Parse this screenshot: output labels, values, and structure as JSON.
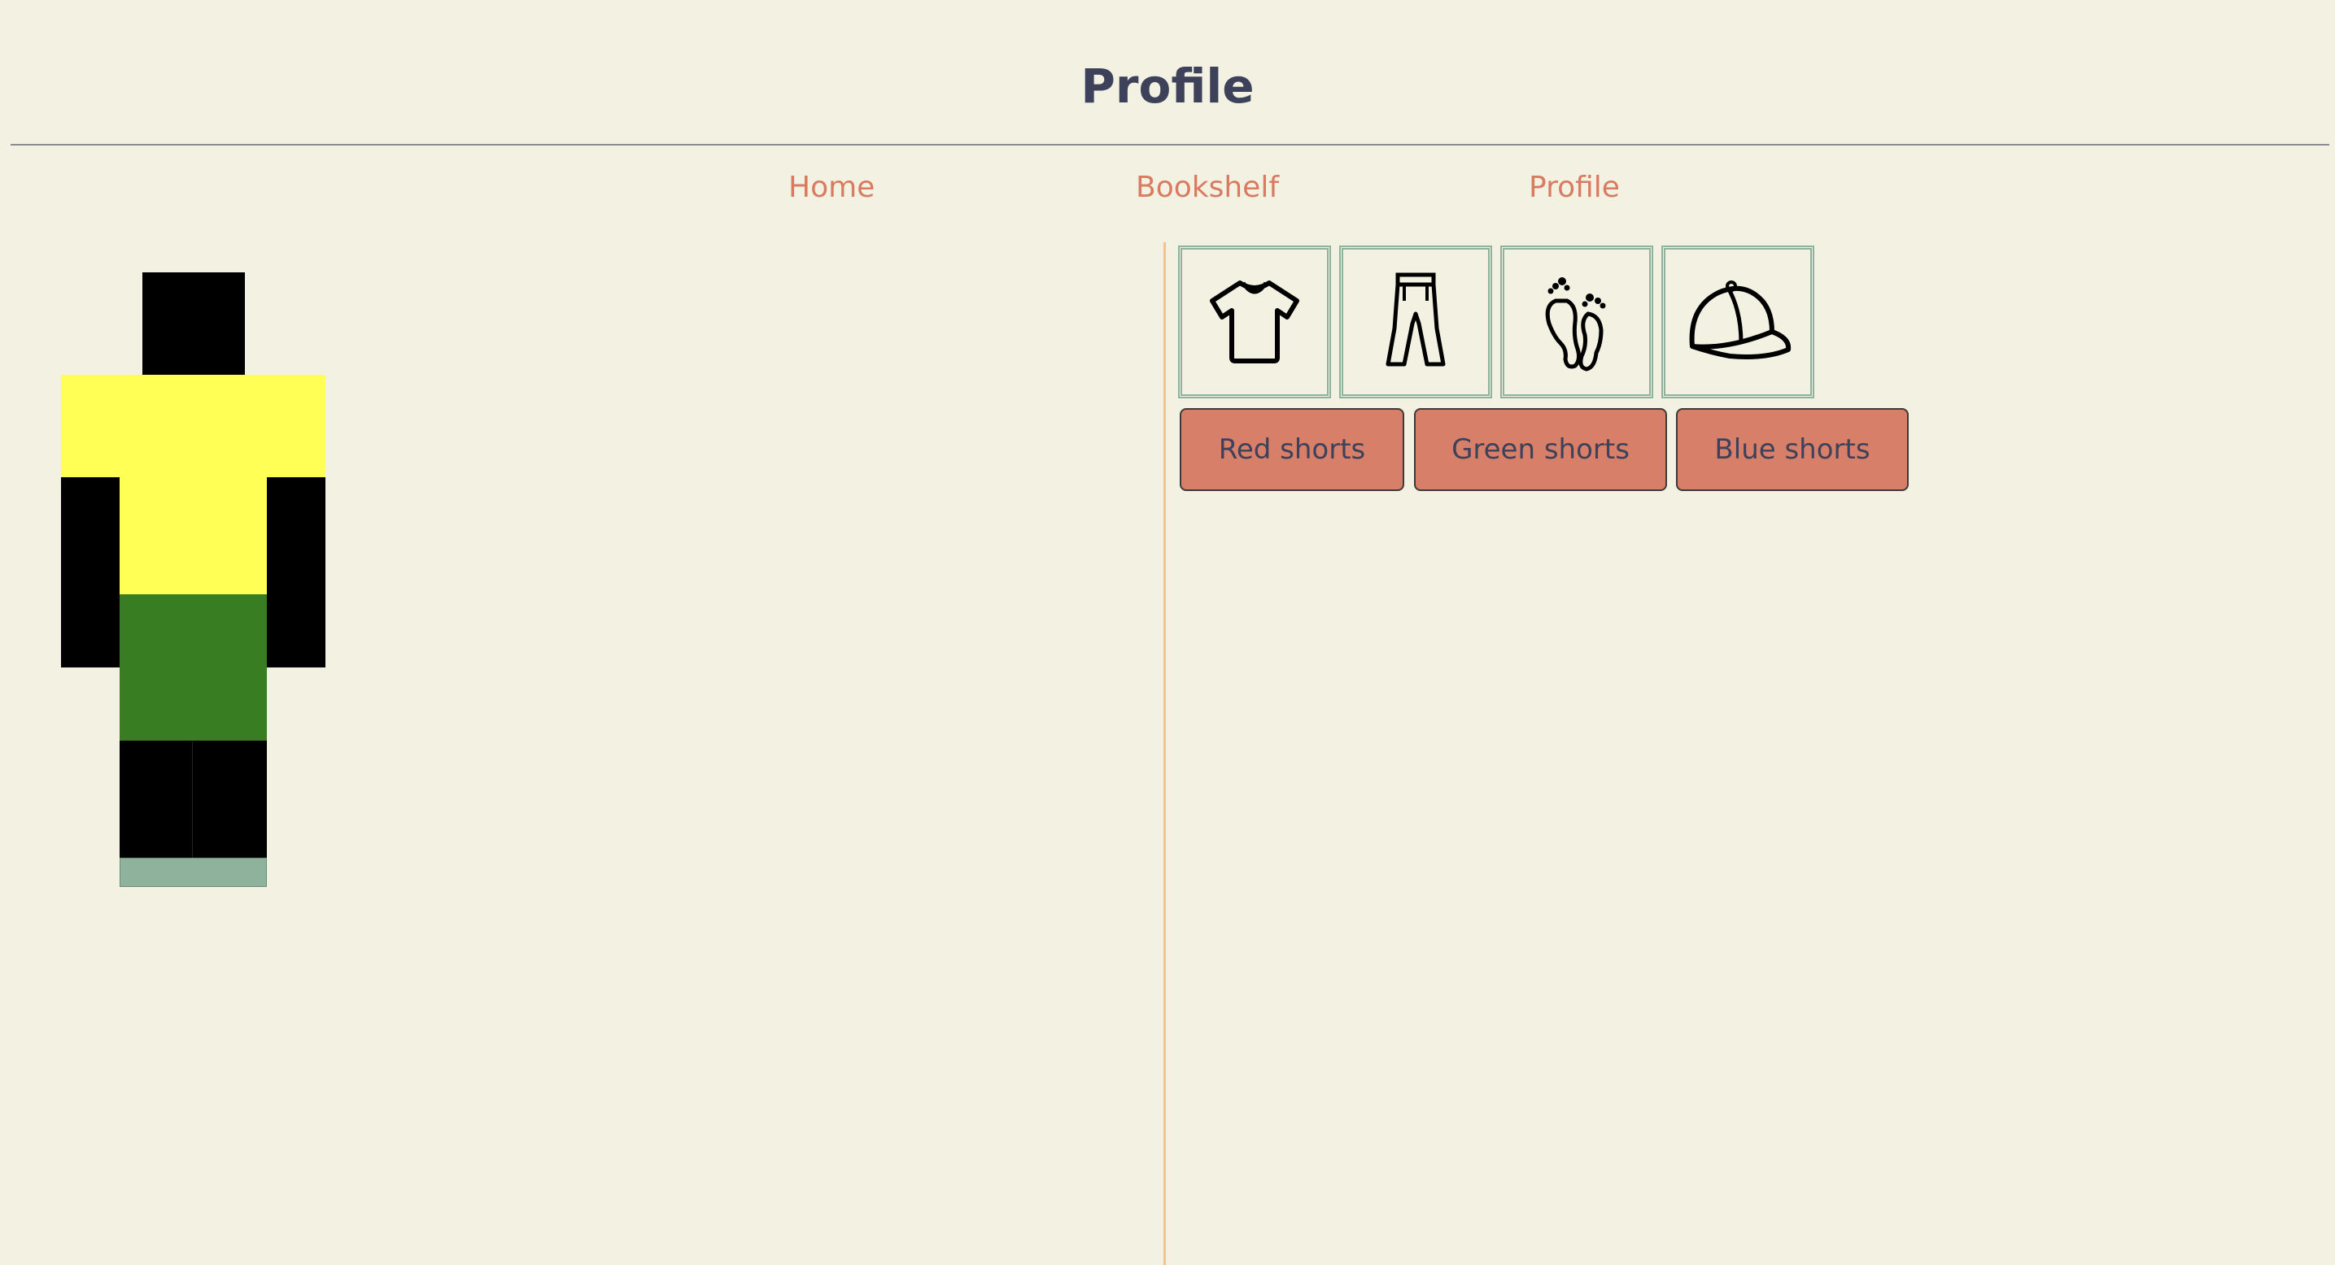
{
  "header": {
    "title": "Profile"
  },
  "nav": {
    "items": [
      {
        "label": "Home"
      },
      {
        "label": "Bookshelf"
      },
      {
        "label": "Profile"
      }
    ]
  },
  "avatar": {
    "colors": {
      "skin": "#000000",
      "shirt": "#ffff55",
      "shorts": "#387d22",
      "shoes": "#8fb29d"
    }
  },
  "categories": [
    {
      "icon": "shirt-icon"
    },
    {
      "icon": "pants-icon"
    },
    {
      "icon": "feet-icon"
    },
    {
      "icon": "cap-icon"
    }
  ],
  "options": [
    {
      "label": "Red shorts"
    },
    {
      "label": "Green shorts"
    },
    {
      "label": "Blue shorts"
    }
  ],
  "colors": {
    "background": "#f3f2e2",
    "title": "#3d4159",
    "nav_link": "#d97b60",
    "button": "#d77f68",
    "separator": "#f2c48c",
    "tile_border": "#8fb29d"
  }
}
